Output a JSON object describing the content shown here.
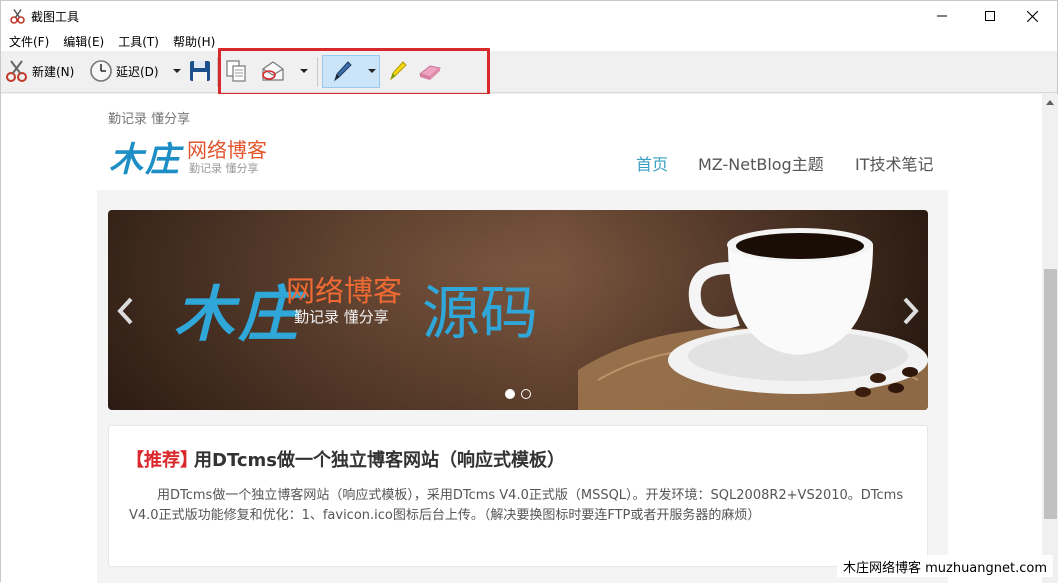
{
  "window": {
    "title": "截图工具"
  },
  "menu": [
    {
      "label": "文件(F)"
    },
    {
      "label": "编辑(E)"
    },
    {
      "label": "工具(T)"
    },
    {
      "label": "帮助(H)"
    }
  ],
  "toolbar": {
    "new_label": "新建(N)",
    "delay_label": "延迟(D)"
  },
  "site": {
    "tagline": "勤记录 懂分享",
    "logo_mark": "木庄",
    "logo_name": "网络博客",
    "logo_sub": "勤记录 懂分享",
    "nav": [
      {
        "label": "首页",
        "active": true
      },
      {
        "label": "MZ-NetBlog主题",
        "active": false
      },
      {
        "label": "IT技术笔记",
        "active": false
      }
    ]
  },
  "banner": {
    "mark": "木庄",
    "name": "网络博客",
    "sub": "勤记录  懂分享",
    "source": "源码",
    "active_slide": 1,
    "slides": 2
  },
  "post": {
    "tag": "【推荐】",
    "title": "用DTcms做一个独立博客网站（响应式模板）",
    "body": "用DTcms做一个独立博客网站（响应式模板），采用DTcms V4.0正式版（MSSQL）。开发环境：SQL2008R2+VS2010。DTcms V4.0正式版功能修复和优化：1、favicon.ico图标后台上传。（解决要换图标时要连FTP或者开服务器的麻烦）"
  },
  "watermark": "木庄网络博客 muzhuangnet.com",
  "colors": {
    "highlight": "#d9282c",
    "accent_blue": "#1e8fc6",
    "accent_orange": "#e2552d"
  }
}
